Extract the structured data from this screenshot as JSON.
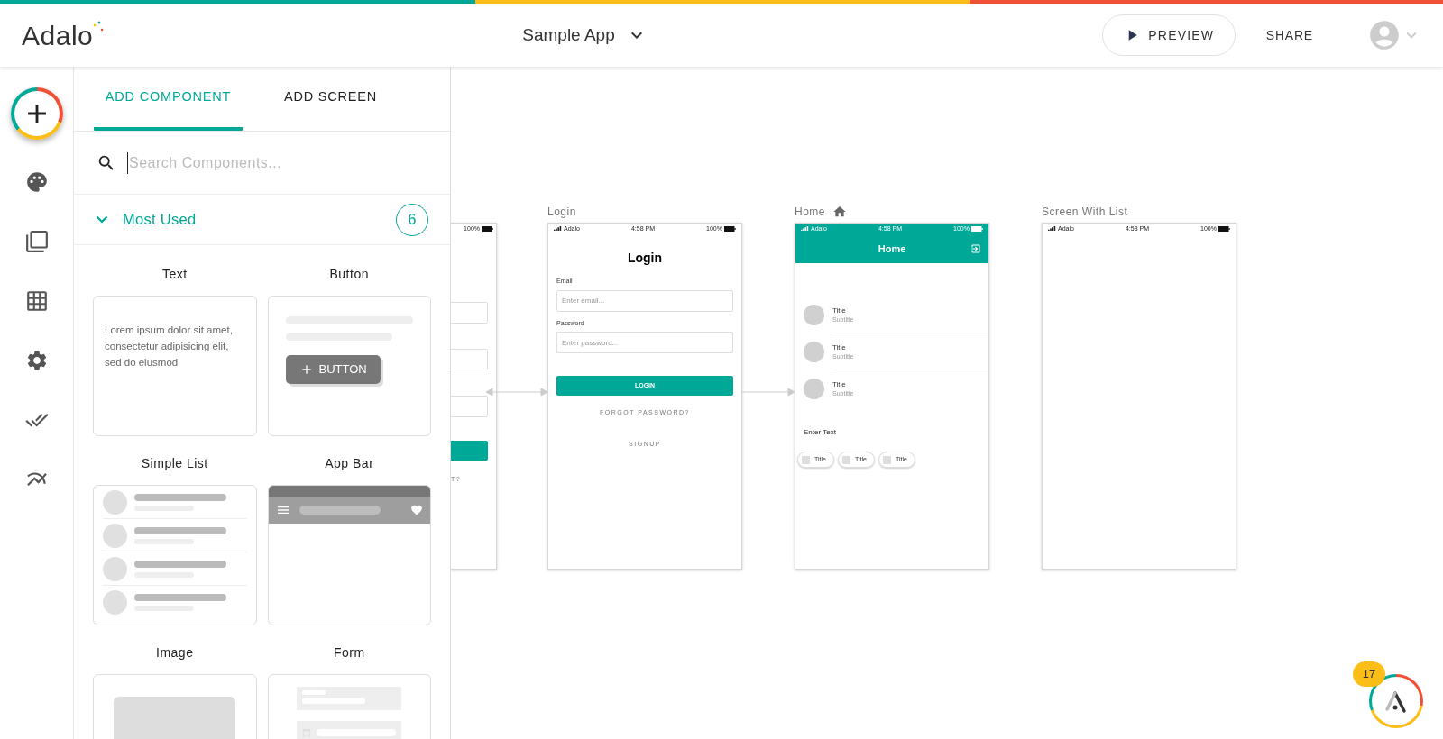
{
  "header": {
    "logo": "Adalo",
    "app_name": "Sample App",
    "preview": "PREVIEW",
    "share": "SHARE"
  },
  "panel": {
    "tabs": [
      {
        "label": "ADD COMPONENT",
        "selected": true
      },
      {
        "label": "ADD SCREEN",
        "selected": false
      }
    ],
    "search": {
      "placeholder": "Search Components..."
    },
    "section": {
      "title": "Most Used",
      "count": "6",
      "expanded": true
    },
    "components": [
      {
        "kind": "text",
        "label": "Text",
        "sample": "Lorem ipsum dolor sit amet, consectetur adipisicing elit, sed do eiusmod"
      },
      {
        "kind": "button",
        "label": "Button",
        "button_label": "BUTTON"
      },
      {
        "kind": "list",
        "label": "Simple List"
      },
      {
        "kind": "app_bar",
        "label": "App Bar"
      },
      {
        "kind": "image",
        "label": "Image"
      },
      {
        "kind": "form",
        "label": "Form"
      }
    ]
  },
  "canvas": {
    "screens": [
      {
        "kind": "partial",
        "battery": "100%",
        "link": "T?"
      },
      {
        "kind": "login",
        "label": "Login",
        "is_home": false,
        "carrier": "Adalo",
        "time": "4:58 PM",
        "battery": "100%",
        "title": "Login",
        "fields": [
          {
            "label": "Email",
            "placeholder": "Enter email..."
          },
          {
            "label": "Password",
            "placeholder": "Enter password..."
          }
        ],
        "button": "LOGIN",
        "links": [
          "FORGOT PASSWORD?",
          "SIGNUP"
        ]
      },
      {
        "kind": "home",
        "label": "Home",
        "is_home": true,
        "carrier": "Adalo",
        "time": "4:58 PM",
        "battery": "100%",
        "title": "Home",
        "list": [
          {
            "title": "Title",
            "subtitle": "Subtitle"
          },
          {
            "title": "Title",
            "subtitle": "Subtitle"
          },
          {
            "title": "Title",
            "subtitle": "Subtitle"
          }
        ],
        "text": "Enter Text",
        "chips": [
          "Title",
          "Title",
          "Title"
        ]
      },
      {
        "kind": "blank",
        "label": "Screen With List",
        "is_home": false,
        "carrier": "Adalo",
        "time": "4:58 PM",
        "battery": "100%"
      }
    ]
  },
  "help_badge": {
    "count": "17"
  }
}
